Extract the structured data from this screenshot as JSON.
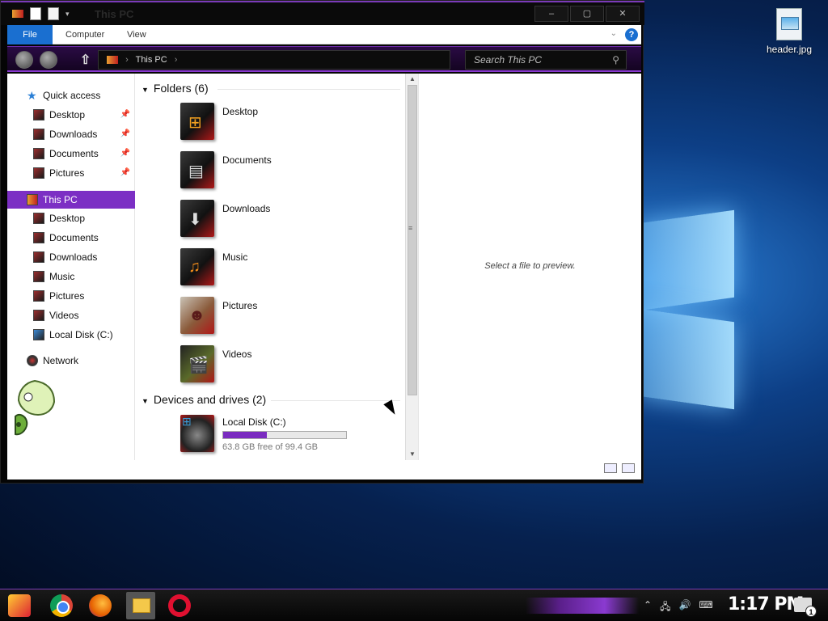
{
  "window": {
    "title": "This PC",
    "controls": {
      "minimize": "–",
      "maximize": "▢",
      "close": "✕"
    }
  },
  "ribbon": {
    "tabs": [
      "File",
      "Computer",
      "View"
    ]
  },
  "address": {
    "path": "This PC",
    "search_placeholder": "Search This PC"
  },
  "nav": {
    "quick_access": "Quick access",
    "quick_items": [
      "Desktop",
      "Downloads",
      "Documents",
      "Pictures"
    ],
    "this_pc": "This PC",
    "pc_items": [
      "Desktop",
      "Documents",
      "Downloads",
      "Music",
      "Pictures",
      "Videos",
      "Local Disk (C:)"
    ],
    "network": "Network"
  },
  "folders_header": "Folders (6)",
  "folders": [
    {
      "name": "Desktop",
      "icon": "desktop-folder-icon"
    },
    {
      "name": "Documents",
      "icon": "documents-folder-icon"
    },
    {
      "name": "Downloads",
      "icon": "downloads-folder-icon"
    },
    {
      "name": "Music",
      "icon": "music-folder-icon"
    },
    {
      "name": "Pictures",
      "icon": "pictures-folder-icon"
    },
    {
      "name": "Videos",
      "icon": "videos-folder-icon"
    }
  ],
  "drives_header": "Devices and drives (2)",
  "drive": {
    "name": "Local Disk (C:)",
    "free_text": "63.8 GB free of 99.4 GB",
    "used_fraction": 0.358
  },
  "preview_message": "Select a file to preview.",
  "desktop": {
    "file_label": "header.jpg"
  },
  "taskbar": {
    "clock": "1:17 PM",
    "notification_count": "1"
  },
  "colors": {
    "accent": "#7c2fc4",
    "file_tab": "#1a6fd0"
  }
}
